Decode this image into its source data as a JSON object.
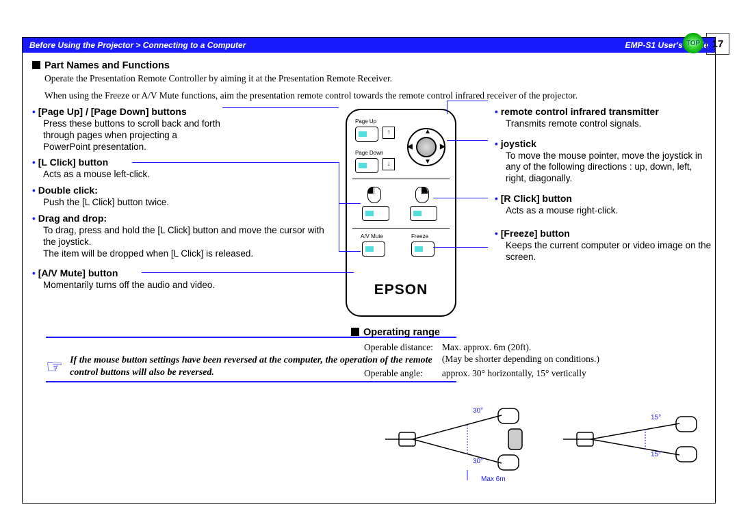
{
  "header": {
    "breadcrumb": "Before Using the Projector > Connecting to a Computer",
    "guide": "EMP-S1 User's Guide",
    "top_label": "TOP",
    "page": "17"
  },
  "section1": {
    "title": "Part Names and Functions",
    "intro1": "Operate the Presentation Remote Controller by aiming it at the Presentation Remote Receiver.",
    "intro2": "When using the Freeze or A/V Mute functions, aim the presentation remote control towards the remote control infrared receiver of the projector."
  },
  "left_items": [
    {
      "title": "[Page Up] / [Page Down] buttons",
      "body": "Press these buttons to scroll back and forth through pages when projecting a PowerPoint presentation."
    },
    {
      "title": "[L Click] button",
      "body": "Acts as a mouse left-click."
    },
    {
      "title": "Double click:",
      "body": "Push the [L Click] button twice."
    },
    {
      "title": "Drag and drop:",
      "body": "To drag, press and hold the [L Click] button and move the cursor with the joystick.\nThe item will be dropped when [L Click] is released."
    },
    {
      "title": "[A/V Mute] button",
      "body": "Momentarily turns off the audio and video."
    }
  ],
  "right_items": [
    {
      "title": "remote control infrared transmitter",
      "body": "Transmits remote control signals."
    },
    {
      "title": "joystick",
      "body": "To move the mouse pointer, move the joystick in any of the following directions : up, down, left, right, diagonally."
    },
    {
      "title": "[R Click] button",
      "body": "Acts as a mouse right-click."
    },
    {
      "title": "[Freeze] button",
      "body": "Keeps the current computer or video image on the screen."
    }
  ],
  "note": "If the mouse button settings have been reversed at the computer, the operation of the remote control buttons will also be reversed.",
  "remote": {
    "page_up": "Page Up",
    "page_down": "Page Down",
    "av_mute": "A/V Mute",
    "freeze": "Freeze",
    "brand": "EPSON"
  },
  "operating_range": {
    "title": "Operating range",
    "distance_label": "Operable distance:",
    "distance_value": "Max. approx. 6m (20ft).",
    "distance_note": "(May be shorter depending on conditions.)",
    "angle_label": "Operable angle:",
    "angle_value": "approx. 30° horizontally, 15° vertically"
  },
  "range_diagram": {
    "h_angle": "30°",
    "v_angle": "15°",
    "max": "Max 6m"
  }
}
